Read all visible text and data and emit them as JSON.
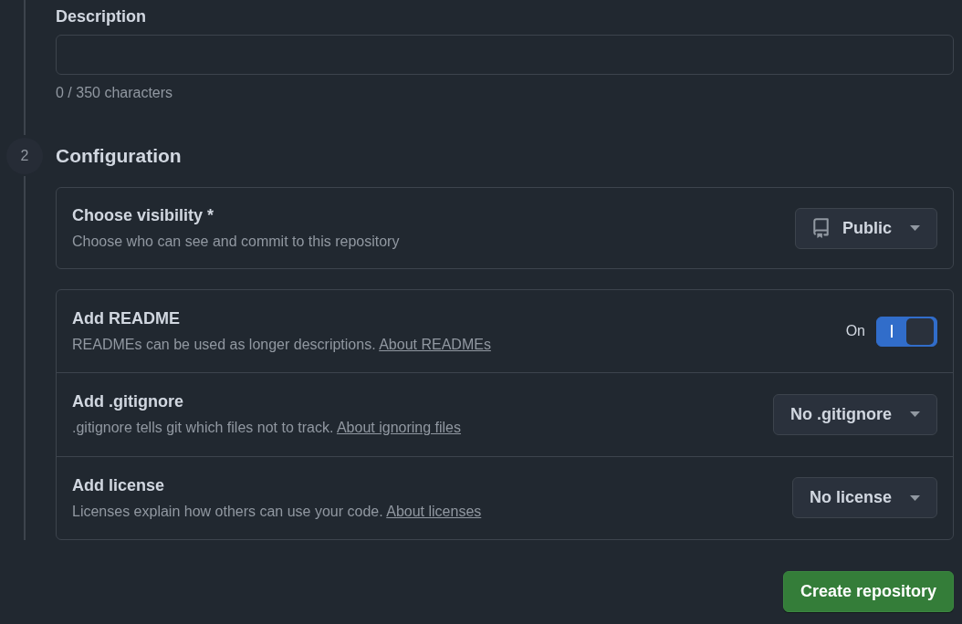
{
  "description_field": {
    "label": "Description",
    "counter": "0 / 350 characters"
  },
  "configuration": {
    "step": "2",
    "title": "Configuration",
    "visibility": {
      "title": "Choose visibility *",
      "description": "Choose who can see and commit to this repository",
      "value": "Public"
    },
    "options": [
      {
        "kind": "toggle",
        "title": "Add README",
        "description": "READMEs can be used as longer descriptions.",
        "link": "About READMEs",
        "on": true,
        "state_label": "On"
      },
      {
        "kind": "select",
        "title": "Add .gitignore",
        "description": ".gitignore tells git which files not to track.",
        "link": "About ignoring files",
        "value": "No .gitignore"
      },
      {
        "kind": "select",
        "title": "Add license",
        "description": "Licenses explain how others can use your code.",
        "link": "About licenses",
        "value": "No license"
      }
    ]
  },
  "submit_button": "Create repository"
}
